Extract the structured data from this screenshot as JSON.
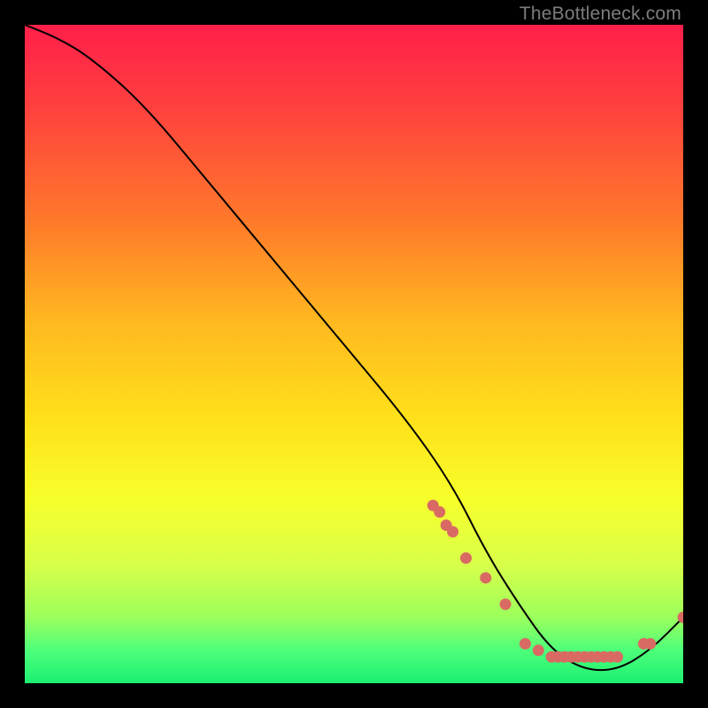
{
  "watermark": "TheBottleneck.com",
  "colors": {
    "curve_stroke": "#000000",
    "marker_fill": "#d96a63",
    "gradient_top": "#ff1f4a",
    "gradient_bottom": "#1cef72"
  },
  "chart_data": {
    "type": "line",
    "title": "",
    "xlabel": "",
    "ylabel": "",
    "xlim": [
      0,
      100
    ],
    "ylim": [
      0,
      100
    ],
    "curve": {
      "x": [
        0,
        5,
        10,
        18,
        28,
        38,
        48,
        58,
        65,
        70,
        75,
        80,
        85,
        90,
        95,
        100
      ],
      "y": [
        100,
        98,
        95,
        88,
        76,
        64,
        52,
        40,
        30,
        20,
        12,
        5,
        2,
        2,
        5,
        10
      ]
    },
    "markers": [
      {
        "x": 62,
        "y": 27
      },
      {
        "x": 63,
        "y": 26
      },
      {
        "x": 64,
        "y": 24
      },
      {
        "x": 65,
        "y": 23
      },
      {
        "x": 67,
        "y": 19
      },
      {
        "x": 70,
        "y": 16
      },
      {
        "x": 73,
        "y": 12
      },
      {
        "x": 76,
        "y": 6
      },
      {
        "x": 78,
        "y": 5
      },
      {
        "x": 80,
        "y": 4
      },
      {
        "x": 81,
        "y": 4
      },
      {
        "x": 82,
        "y": 4
      },
      {
        "x": 83,
        "y": 4
      },
      {
        "x": 84,
        "y": 4
      },
      {
        "x": 85,
        "y": 4
      },
      {
        "x": 86,
        "y": 4
      },
      {
        "x": 87,
        "y": 4
      },
      {
        "x": 88,
        "y": 4
      },
      {
        "x": 89,
        "y": 4
      },
      {
        "x": 90,
        "y": 4
      },
      {
        "x": 94,
        "y": 6
      },
      {
        "x": 95,
        "y": 6
      },
      {
        "x": 100,
        "y": 10
      }
    ]
  }
}
